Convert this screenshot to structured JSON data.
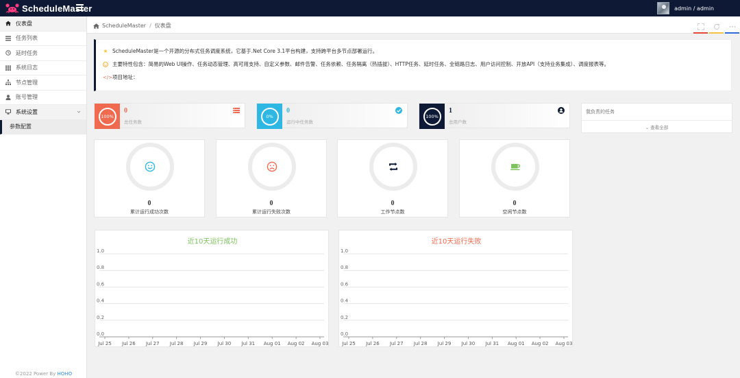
{
  "app": {
    "brand": "ScheduleMaster"
  },
  "header": {
    "user": "admin / admin"
  },
  "sidebar": {
    "items": [
      {
        "label": "仪表盘",
        "icon": "home-icon"
      },
      {
        "label": "任务列表",
        "icon": "list-icon"
      },
      {
        "label": "延时任务",
        "icon": "clock-icon"
      },
      {
        "label": "系统日志",
        "icon": "grid-icon"
      },
      {
        "label": "节点管理",
        "icon": "sitemap-icon"
      },
      {
        "label": "账号管理",
        "icon": "user-icon"
      },
      {
        "label": "系统设置",
        "icon": "monitor-icon"
      },
      {
        "label": "参数配置",
        "icon": ""
      }
    ],
    "footer_prefix": "©2022 Power By ",
    "footer_link": "HOHO"
  },
  "breadcrumb": {
    "home": "ScheduleMaster",
    "current": "仪表盘"
  },
  "toolbar": {
    "colors": [
      "#e8463a",
      "#f6c343",
      "#2d6cdf"
    ]
  },
  "notice": {
    "line1": "ScheduleMaster是一个开源的分布式任务调度系统，它基于.Net Core 3.1平台构建，支持跨平台多节点部署运行。",
    "line2": "主要特性包含：简易的Web UI操作、任务动态管理、高可用支持、自定义参数、邮件告警、任务依赖、任务隔离（热插拔）、HTTP任务、延时任务、全链路日志、用户访问控制、开放API（支持业务集成）、调度报表等。",
    "line3": "项目地址："
  },
  "stats": [
    {
      "value": "0",
      "label": "总任务数",
      "ring": "100%",
      "color": "#f06a4f",
      "icon": "list-icon"
    },
    {
      "value": "0",
      "label": "运行中任务数",
      "ring": "0%",
      "color": "#2fb7e4",
      "icon": "check-circle-icon"
    },
    {
      "value": "1",
      "label": "总用户数",
      "ring": "100%",
      "color": "#0e1a35",
      "icon": "user-circle-icon"
    }
  ],
  "my_tasks": {
    "title": "我负责的任务",
    "more": "⌄ 查看全部"
  },
  "cards": [
    {
      "value": "0",
      "label": "累计运行成功次数",
      "icon": "smile-icon",
      "color": "#2fb7e4"
    },
    {
      "value": "0",
      "label": "累计运行失败次数",
      "icon": "frown-icon",
      "color": "#f06a4f"
    },
    {
      "value": "0",
      "label": "工作节点数",
      "icon": "retweet-icon",
      "color": "#0e1a35"
    },
    {
      "value": "0",
      "label": "空闲节点数",
      "icon": "coffee-icon",
      "color": "#7cc35c"
    }
  ],
  "chart_data": [
    {
      "type": "line",
      "title": "近10天运行成功",
      "title_color": "#7cc35c",
      "categories": [
        "Jul 25",
        "Jul 26",
        "Jul 27",
        "Jul 28",
        "Jul 29",
        "Jul 30",
        "Jul 31",
        "Aug 01",
        "Aug 02",
        "Aug 03"
      ],
      "series": [],
      "ylim": [
        0,
        1
      ],
      "yticks": [
        "0.0",
        "0.2",
        "0.4",
        "0.6",
        "0.8",
        "1.0"
      ],
      "grid": true
    },
    {
      "type": "line",
      "title": "近10天运行失败",
      "title_color": "#f06a4f",
      "categories": [
        "Jul 25",
        "Jul 26",
        "Jul 27",
        "Jul 28",
        "Jul 29",
        "Jul 30",
        "Jul 31",
        "Aug 01",
        "Aug 02",
        "Aug 03"
      ],
      "series": [],
      "ylim": [
        0,
        1
      ],
      "yticks": [
        "0.0",
        "0.2",
        "0.4",
        "0.6",
        "0.8",
        "1.0"
      ],
      "grid": true
    }
  ]
}
